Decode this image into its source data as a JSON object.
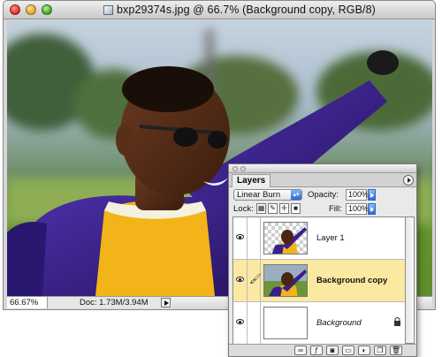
{
  "window": {
    "title": "bxp29374s.jpg @ 66.7% (Background copy, RGB/8)"
  },
  "statusbar": {
    "zoom": "66.67%",
    "doc_info": "Doc: 1.73M/3.94M"
  },
  "layers_panel": {
    "tab_label": "Layers",
    "blend_mode": "Linear Burn",
    "opacity_label": "Opacity:",
    "opacity_value": "100%",
    "lock_label": "Lock:",
    "fill_label": "Fill:",
    "fill_value": "100%",
    "layers": [
      {
        "name": "Layer 1",
        "visible": true,
        "active": false,
        "locked": false
      },
      {
        "name": "Background copy",
        "visible": true,
        "active": true,
        "locked": false
      },
      {
        "name": "Background",
        "visible": true,
        "active": false,
        "locked": true
      }
    ],
    "bottom_icons": [
      "link-layers-icon",
      "layer-style-icon",
      "layer-mask-icon",
      "new-group-icon",
      "adjustment-layer-icon",
      "new-layer-icon",
      "trash-icon"
    ]
  },
  "colors": {
    "active_layer_bg": "#fbe9a2",
    "jacket_purple": "#3a1f8a",
    "sweater_yellow": "#f2b418"
  }
}
